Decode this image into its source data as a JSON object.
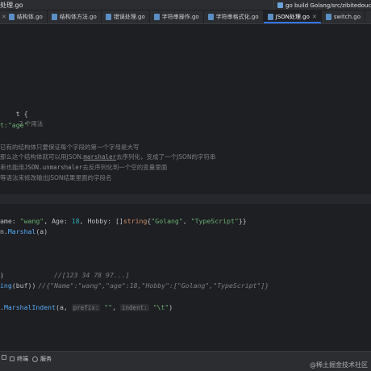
{
  "titlebar": {
    "file": "处理.go",
    "run_config": "go build Golang/src/zibitedouce_code (2"
  },
  "tabs": [
    {
      "label": "结构体.go",
      "active": false
    },
    {
      "label": "结构体方法.go",
      "active": false
    },
    {
      "label": "错误处理.go",
      "active": false
    },
    {
      "label": "字符串操作.go",
      "active": false
    },
    {
      "label": "字符串格式化.go",
      "active": false
    },
    {
      "label": "JSON处理.go",
      "active": true
    },
    {
      "label": "switch.go",
      "active": false
    }
  ],
  "code": {
    "struct_line_prefix": "t {",
    "struct_usage": "2 个用法",
    "tag_line": "t:\"age\"`",
    "doc_1": "已有的结构体只要保证每个字段的第一个字母是大写",
    "doc_2_a": "那么这个结构体就可以用JSON.",
    "doc_2_b": "marshaler",
    "doc_2_c": "去序列化，变成了一个JSON的字符串",
    "doc_3_a": "串也能用",
    "doc_3_b": "JSON.unmarshaler",
    "doc_3_c": "去反序列化到一个空的变量里面",
    "doc_4": "等语法来修改输出JSON结果里面的字段名",
    "init_a": "ame: ",
    "init_name": "\"wang\"",
    "init_b": ", Age: ",
    "init_age": "18",
    "init_c": ", Hobby: []",
    "init_type": "string",
    "init_d": "{",
    "init_h1": "\"Golang\"",
    "init_e": ", ",
    "init_h2": "\"TypeScript\"",
    "init_f": "}}",
    "marshal_a": "n.",
    "marshal_fn": "Marshal",
    "marshal_b": "(a)",
    "print_buf": ")",
    "print_buf_cmt": "//[123 34 78 97...]",
    "print_str_fn": "ing",
    "print_str_b": "(buf))",
    "print_str_cmt": "//{\"Name\":\"wang\",\"age\":18,\"Hobby\":[\"Golang\",\"TypeScript\"]}",
    "indent_a": ".",
    "indent_fn": "MarshalIndent",
    "indent_b": "(a, ",
    "indent_hint_prefix": "prefix:",
    "indent_prefix_val": "\"\"",
    "indent_c": ", ",
    "indent_hint_indent": "indent:",
    "indent_indent_val": "\"\\t\"",
    "indent_d": ")"
  },
  "bottom_bar": {
    "terminal": "终端",
    "services": "服务"
  },
  "watermark": "@稀土掘金技术社区"
}
